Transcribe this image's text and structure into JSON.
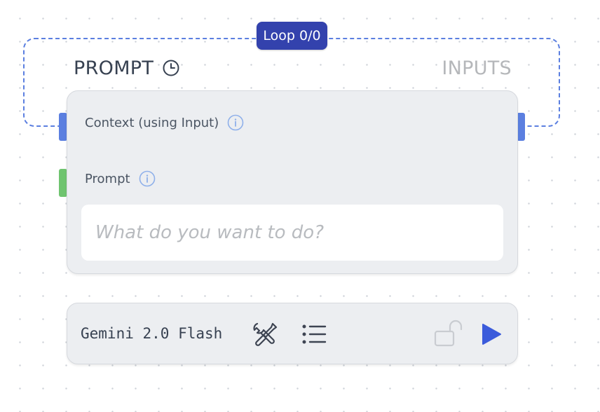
{
  "loop": {
    "badge_label": "Loop 0/0"
  },
  "node": {
    "title": "PROMPT",
    "title_icon": "clock-icon",
    "inputs_label": "INPUTS",
    "fields": [
      {
        "label": "Context (using Input)",
        "icon": "info-icon"
      },
      {
        "label": "Prompt",
        "icon": "info-icon"
      }
    ],
    "prompt_input": {
      "value": "",
      "placeholder": "What do you want to do?"
    }
  },
  "toolbar": {
    "model_name": "Gemini 2.0 Flash",
    "icons": [
      "tools-icon",
      "list-icon",
      "unlock-icon",
      "play-icon"
    ]
  },
  "colors": {
    "accent": "#3342ad",
    "loop_border": "#5b7fe0",
    "handle_blue": "#5b7fe0",
    "handle_green": "#6fc46f",
    "play": "#3b5bdb",
    "card_bg": "#eceef1"
  }
}
